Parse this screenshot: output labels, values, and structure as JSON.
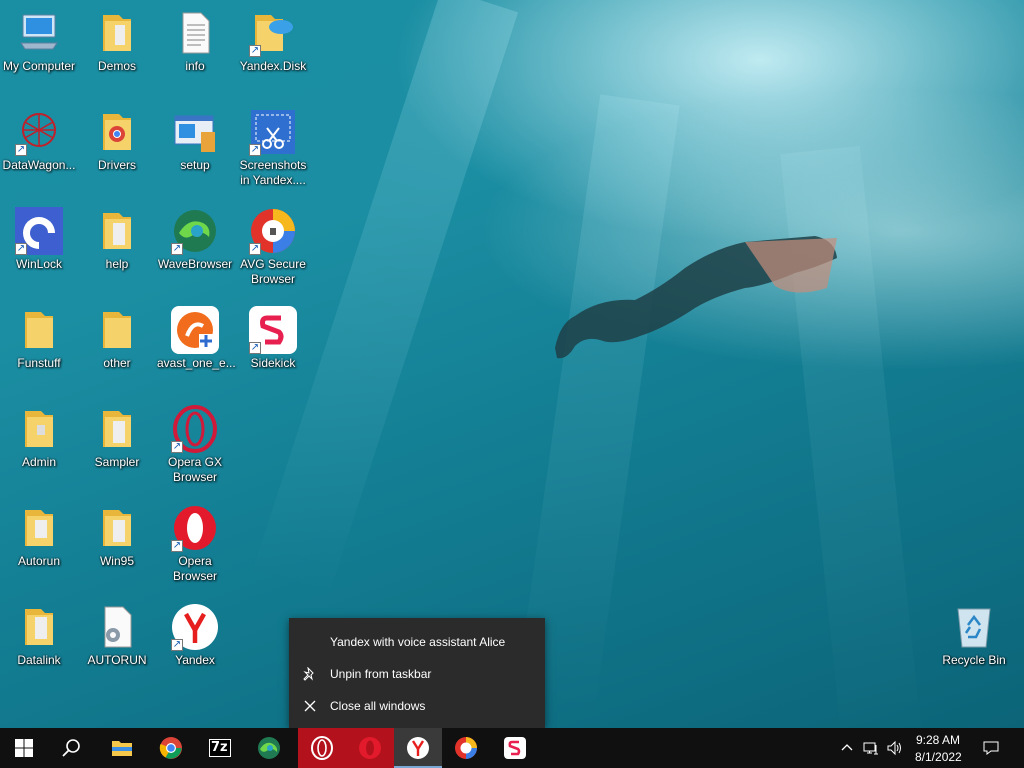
{
  "desktop": {
    "icons": [
      {
        "label": "My Computer"
      },
      {
        "label": "Demos"
      },
      {
        "label": "info"
      },
      {
        "label": "Yandex.Disk"
      },
      {
        "label": "DataWagon..."
      },
      {
        "label": "Drivers"
      },
      {
        "label": "setup"
      },
      {
        "label": "Screenshots in Yandex...."
      },
      {
        "label": "WinLock"
      },
      {
        "label": "help"
      },
      {
        "label": "WaveBrowser"
      },
      {
        "label": "AVG Secure Browser"
      },
      {
        "label": "Funstuff"
      },
      {
        "label": "other"
      },
      {
        "label": "avast_one_e..."
      },
      {
        "label": "Sidekick"
      },
      {
        "label": "Admin"
      },
      {
        "label": "Sampler"
      },
      {
        "label": "Opera GX Browser"
      },
      {
        "label": "Autorun"
      },
      {
        "label": "Win95"
      },
      {
        "label": "Opera Browser"
      },
      {
        "label": "Datalink"
      },
      {
        "label": "AUTORUN"
      },
      {
        "label": "Yandex"
      },
      {
        "label": "Recycle Bin"
      }
    ]
  },
  "context_menu": {
    "title": "Yandex with voice assistant Alice",
    "unpin_label": "Unpin from taskbar",
    "close_all_label": "Close all windows"
  },
  "taskbar": {
    "clock_time": "9:28 AM",
    "clock_date": "8/1/2022",
    "seven_zip_label": "7z"
  },
  "colors": {
    "taskbar_bg": "#101010",
    "menu_bg": "#2b2b2b",
    "opera_red": "#b3121c",
    "folder_yellow": "#f5c84c"
  }
}
